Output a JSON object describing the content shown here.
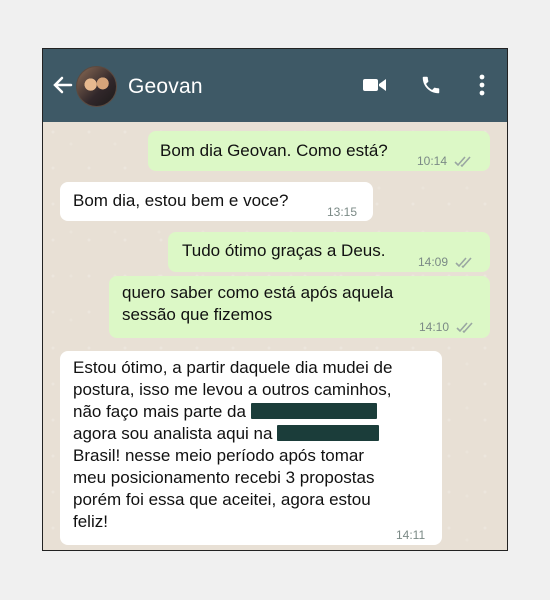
{
  "header": {
    "contact_name": "Geovan"
  },
  "icons": {
    "back": "arrow-left-icon",
    "video": "video-camera-icon",
    "call": "phone-icon",
    "more": "more-vertical-icon"
  },
  "colors": {
    "header": "#3e5966",
    "chat_bg": "#e8e0d5",
    "outgoing_bubble": "#dcf8c6",
    "incoming_bubble": "#ffffff",
    "read_check": "#4da5e3",
    "redaction": "#1b3d3a"
  },
  "messages": [
    {
      "direction": "outgoing",
      "text": "Bom dia Geovan. Como está?",
      "time": "10:14",
      "status": "read"
    },
    {
      "direction": "incoming",
      "text": "Bom dia, estou bem e voce?",
      "time": "13:15"
    },
    {
      "direction": "outgoing",
      "text": "Tudo ótimo graças a Deus.",
      "time": "14:09",
      "status": "read"
    },
    {
      "direction": "outgoing",
      "line1": "quero saber como está após aquela",
      "line2": "sessão que fizemos",
      "time": "14:10",
      "status": "read"
    },
    {
      "direction": "incoming",
      "line1": "Estou ótimo, a partir daquele dia mudei de",
      "line2": "postura, isso me levou a outros caminhos,",
      "line3_prefix": "não faço mais parte da",
      "line4_prefix": "agora sou analista aqui na",
      "line5": "Brasil! nesse meio período após tomar",
      "line6": "meu posicionamento recebi 3 propostas",
      "line7": "porém foi essa que aceitei, agora estou",
      "line8": "feliz!",
      "time": "14:11"
    }
  ]
}
